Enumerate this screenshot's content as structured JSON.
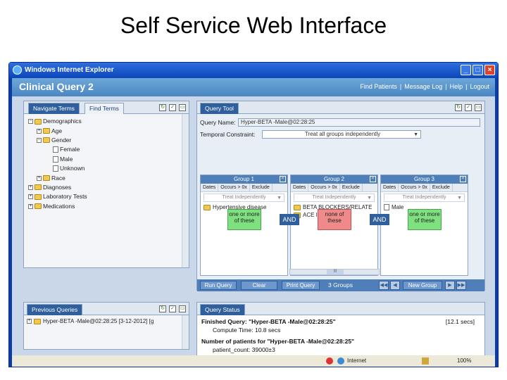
{
  "slide": {
    "title": "Self Service Web Interface"
  },
  "window": {
    "title": "Windows Internet Explorer",
    "buttons": [
      "_",
      "□",
      "×"
    ]
  },
  "app": {
    "title": "Clinical Query 2",
    "links": [
      "Find Patients",
      "|",
      "Message Log",
      "|",
      "Help",
      "|",
      "Logout"
    ]
  },
  "left_panel": {
    "tabs": [
      "Navigate Terms",
      "Find Terms"
    ],
    "tree": [
      {
        "label": "Demographics",
        "level": 0,
        "toggle": "⊟",
        "icon": "folder"
      },
      {
        "label": "Age",
        "level": 1,
        "toggle": "⊞",
        "icon": "folder"
      },
      {
        "label": "Gender",
        "level": 1,
        "toggle": "⊟",
        "icon": "folder"
      },
      {
        "label": "Female",
        "level": 2,
        "toggle": "",
        "icon": "doc"
      },
      {
        "label": "Male",
        "level": 2,
        "toggle": "",
        "icon": "doc"
      },
      {
        "label": "Unknown",
        "level": 2,
        "toggle": "",
        "icon": "doc"
      },
      {
        "label": "Race",
        "level": 1,
        "toggle": "⊞",
        "icon": "folder"
      },
      {
        "label": "Diagnoses",
        "level": 0,
        "toggle": "⊞",
        "icon": "folder"
      },
      {
        "label": "Laboratory Tests",
        "level": 0,
        "toggle": "⊞",
        "icon": "folder"
      },
      {
        "label": "Medications",
        "level": 0,
        "toggle": "⊞",
        "icon": "folder"
      }
    ]
  },
  "query_tool": {
    "tab": "Query Tool",
    "query_name_label": "Query Name:",
    "query_name_value": "Hyper-BETA -Male@02:28:25",
    "temporal_label": "Temporal Constraint:",
    "temporal_value": "Treat all groups independently",
    "groups": [
      {
        "title": "Group 1",
        "buttons": [
          "Dates",
          "Occurs > 0x",
          "Exclude"
        ],
        "select": "Treat Independently",
        "items": [
          "Hypertensive disease"
        ],
        "badge": "one or more of these",
        "badge_color": "#7fe07f"
      },
      {
        "title": "Group 2",
        "buttons": [
          "Dates",
          "Occurs > 0x",
          "Exclude"
        ],
        "select": "Treat Independently",
        "items": [
          "BETA BLOCKERS/RELATE",
          "ACE INHIBITORS"
        ],
        "badge": "none of these",
        "badge_color": "#f08a8a"
      },
      {
        "title": "Group 3",
        "buttons": [
          "Dates",
          "Occurs > 0x",
          "Exclude"
        ],
        "select": "Treat Independently",
        "items": [
          "Male"
        ],
        "badge": "one or more of these",
        "badge_color": "#7fe07f"
      }
    ],
    "and_labels": [
      "AND",
      "AND"
    ],
    "scroll_thumb": "III",
    "buttons": {
      "run": "Run Query",
      "clear": "Clear",
      "print": "Print Query",
      "new_group": "New Group"
    },
    "group_count": "3 Groups"
  },
  "previous_queries": {
    "tab": "Previous Queries",
    "item": "Hyper-BETA -Male@02:28:25 [3-12-2012] [g"
  },
  "query_status": {
    "tab": "Query Status",
    "finished": "Finished Query: \"Hyper-BETA -Male@02:28:25\"",
    "finished_time": "[12.1 secs]",
    "compute_time": "Compute Time: 10.8 secs",
    "patients_label": "Number of patients for \"Hyper-BETA -Male@02:28:25\"",
    "patient_count": "patient_count: 39000±3"
  },
  "statusbar": {
    "zone": "Internet",
    "zoom": "100%"
  }
}
